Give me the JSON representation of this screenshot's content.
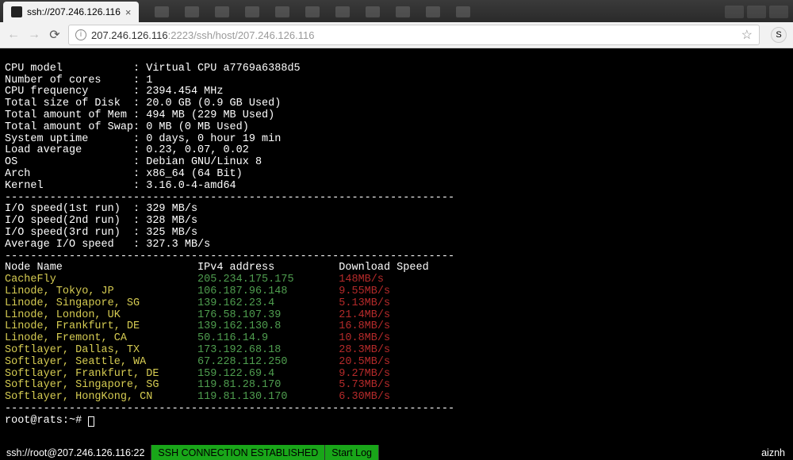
{
  "tab": {
    "title": "ssh://207.246.126.116"
  },
  "addr": {
    "host": "207.246.126.116",
    "port": ":2223",
    "path": "/ssh/host/207.246.126.116"
  },
  "sysinfo": [
    {
      "label": "CPU model",
      "value": "Virtual CPU a7769a6388d5"
    },
    {
      "label": "Number of cores",
      "value": "1"
    },
    {
      "label": "CPU frequency",
      "value": "2394.454 MHz"
    },
    {
      "label": "Total size of Disk",
      "value": "20.0 GB (0.9 GB Used)"
    },
    {
      "label": "Total amount of Mem",
      "value": "494 MB (229 MB Used)"
    },
    {
      "label": "Total amount of Swap",
      "value": "0 MB (0 MB Used)"
    },
    {
      "label": "System uptime",
      "value": "0 days, 0 hour 19 min"
    },
    {
      "label": "Load average",
      "value": "0.23, 0.07, 0.02"
    },
    {
      "label": "OS",
      "value": "Debian GNU/Linux 8"
    },
    {
      "label": "Arch",
      "value": "x86_64 (64 Bit)"
    },
    {
      "label": "Kernel",
      "value": "3.16.0-4-amd64"
    }
  ],
  "iospeed": [
    {
      "label": "I/O speed(1st run)",
      "value": "329 MB/s"
    },
    {
      "label": "I/O speed(2nd run)",
      "value": "328 MB/s"
    },
    {
      "label": "I/O speed(3rd run)",
      "value": "325 MB/s"
    },
    {
      "label": "Average I/O speed",
      "value": "327.3 MB/s"
    }
  ],
  "speedtest": {
    "headers": {
      "name": "Node Name",
      "ip": "IPv4 address",
      "speed": "Download Speed"
    },
    "rows": [
      {
        "name": "CacheFly",
        "ip": "205.234.175.175",
        "speed": "148MB/s"
      },
      {
        "name": "Linode, Tokyo, JP",
        "ip": "106.187.96.148",
        "speed": "9.55MB/s"
      },
      {
        "name": "Linode, Singapore, SG",
        "ip": "139.162.23.4",
        "speed": "5.13MB/s"
      },
      {
        "name": "Linode, London, UK",
        "ip": "176.58.107.39",
        "speed": "21.4MB/s"
      },
      {
        "name": "Linode, Frankfurt, DE",
        "ip": "139.162.130.8",
        "speed": "16.8MB/s"
      },
      {
        "name": "Linode, Fremont, CA",
        "ip": "50.116.14.9",
        "speed": "10.8MB/s"
      },
      {
        "name": "Softlayer, Dallas, TX",
        "ip": "173.192.68.18",
        "speed": "28.3MB/s"
      },
      {
        "name": "Softlayer, Seattle, WA",
        "ip": "67.228.112.250",
        "speed": "20.5MB/s"
      },
      {
        "name": "Softlayer, Frankfurt, DE",
        "ip": "159.122.69.4",
        "speed": "9.27MB/s"
      },
      {
        "name": "Softlayer, Singapore, SG",
        "ip": "119.81.28.170",
        "speed": "5.73MB/s"
      },
      {
        "name": "Softlayer, HongKong, CN",
        "ip": "119.81.130.170",
        "speed": "6.30MB/s"
      }
    ]
  },
  "prompt": "root@rats:~# ",
  "statusbar": {
    "conn": "ssh://root@207.246.126.116:22",
    "msg": "SSH CONNECTION ESTABLISHED",
    "startlog": "Start Log",
    "brand": "aiznh"
  },
  "avatar_letter": "S"
}
